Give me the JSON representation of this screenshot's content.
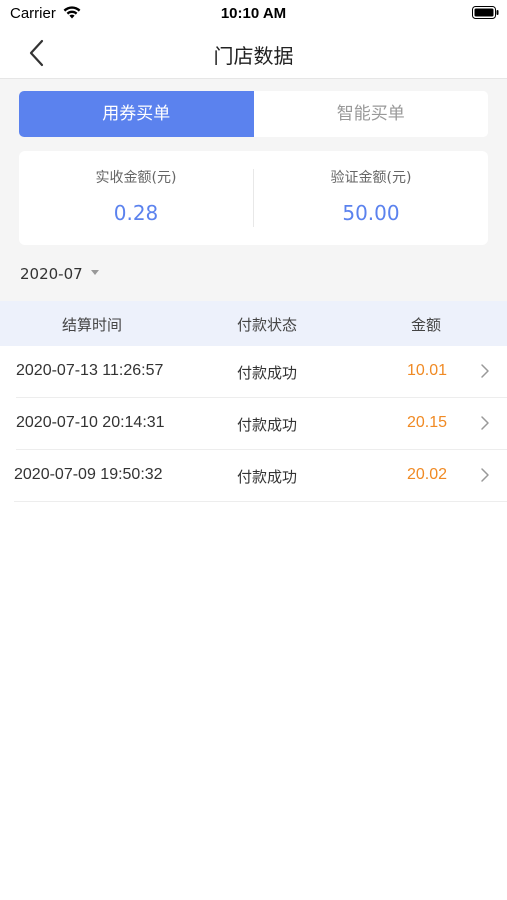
{
  "status_bar": {
    "carrier": "Carrier",
    "time": "10:10 AM"
  },
  "nav": {
    "title": "门店数据"
  },
  "tabs": [
    {
      "label": "用券买单",
      "active": true
    },
    {
      "label": "智能买单",
      "active": false
    }
  ],
  "summary": {
    "received_label": "实收金额(元)",
    "received_value": "0.28",
    "verified_label": "验证金额(元)",
    "verified_value": "50.00"
  },
  "month_filter": {
    "value": "2020-07"
  },
  "table": {
    "headers": {
      "time": "结算时间",
      "status": "付款状态",
      "amount": "金额"
    },
    "rows": [
      {
        "time": "2020-07-13 11:26:57",
        "status": "付款成功",
        "amount": "10.01"
      },
      {
        "time": "2020-07-10 20:14:31",
        "status": "付款成功",
        "amount": "20.15"
      },
      {
        "time": "2020-07-09 19:50:32",
        "status": "付款成功",
        "amount": "20.02"
      }
    ]
  },
  "colors": {
    "accent": "#5b82ee",
    "amount": "#f08a24",
    "header_bg": "#edf1fb"
  },
  "icons": {
    "back": "chevron-left-icon",
    "row_arrow": "chevron-right-icon",
    "wifi": "wifi-icon",
    "battery": "battery-icon",
    "dropdown": "caret-down-icon"
  }
}
